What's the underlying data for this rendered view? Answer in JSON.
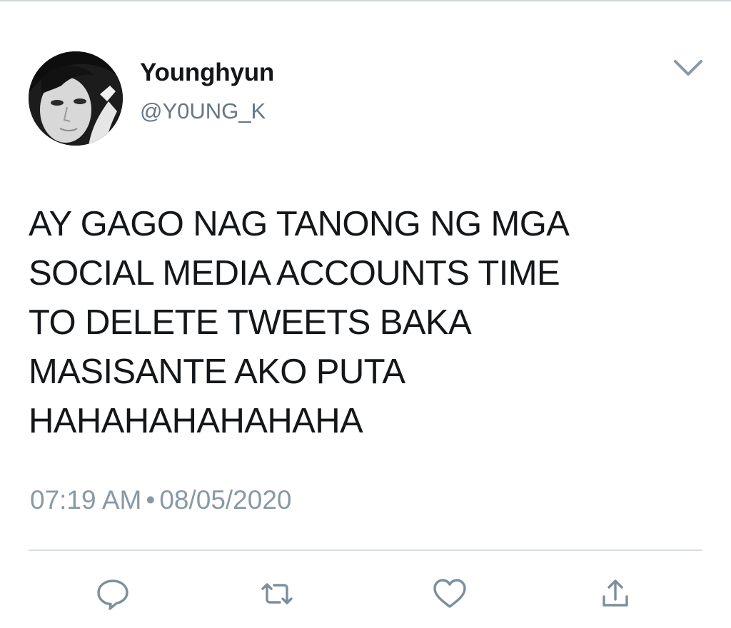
{
  "tweet": {
    "author": {
      "display_name": "Younghyun",
      "handle": "@Y0UNG_K"
    },
    "text_lines": [
      "AY GAGO NAG TANONG NG MGA",
      "SOCIAL MEDIA ACCOUNTS TIME",
      "TO DELETE TWEETS BAKA",
      "MASISANTE AKO PUTA",
      "HAHAHAHAHAHAHA"
    ],
    "time": "07:19 AM",
    "separator": "•",
    "date": "08/05/2020"
  },
  "icons": {
    "menu": "chevron-down-icon",
    "reply": "reply-icon",
    "retweet": "retweet-icon",
    "like": "heart-icon",
    "share": "share-icon"
  },
  "colors": {
    "text": "#14171a",
    "secondary": "#657786",
    "muted": "#8899a6",
    "icon": "#7d8f9c",
    "divider": "#d8dde1"
  }
}
